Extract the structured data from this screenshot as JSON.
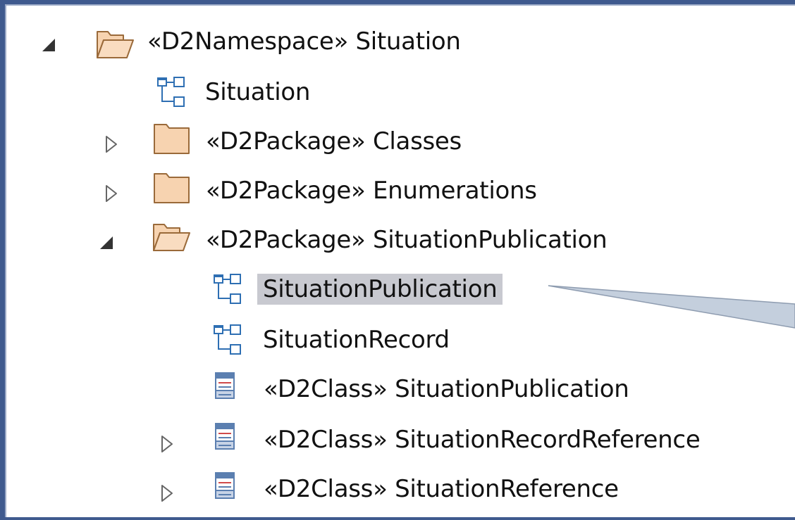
{
  "tree": {
    "items": [
      {
        "label": "«D2Namespace» Situation",
        "icon": "folder-open-icon",
        "toggle": "expanded"
      },
      {
        "label": "Situation",
        "icon": "diagram-icon",
        "toggle": "none"
      },
      {
        "label": "«D2Package» Classes",
        "icon": "folder-closed-icon",
        "toggle": "collapsed"
      },
      {
        "label": "«D2Package» Enumerations",
        "icon": "folder-closed-icon",
        "toggle": "collapsed"
      },
      {
        "label": "«D2Package» SituationPublication",
        "icon": "folder-open-icon",
        "toggle": "expanded"
      },
      {
        "label": "SituationPublication",
        "icon": "diagram-icon",
        "toggle": "none",
        "selected": true
      },
      {
        "label": "SituationRecord",
        "icon": "diagram-icon",
        "toggle": "none"
      },
      {
        "label": "«D2Class» SituationPublication",
        "icon": "class-icon",
        "toggle": "none"
      },
      {
        "label": "«D2Class» SituationRecordReference",
        "icon": "class-icon",
        "toggle": "collapsed"
      },
      {
        "label": "«D2Class» SituationReference",
        "icon": "class-icon",
        "toggle": "collapsed"
      }
    ]
  },
  "colors": {
    "window_background": "#3f5a8e",
    "selection": "#c8c9d0",
    "folder_fill": "#f7d3b0",
    "folder_stroke": "#9a6a3a",
    "callout_fill": "#c4cfdd"
  }
}
